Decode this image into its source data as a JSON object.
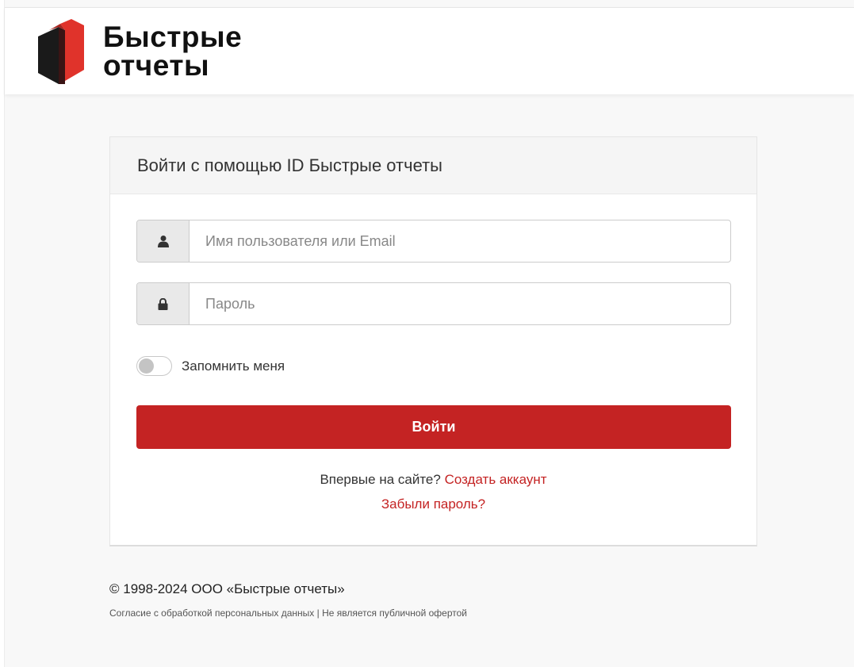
{
  "header": {
    "logo_line1": "Быстрые",
    "logo_line2": "отчеты"
  },
  "login": {
    "title": "Войти с помощью ID Быстрые отчеты",
    "username_placeholder": "Имя пользователя или Email",
    "username_value": "",
    "password_placeholder": "Пароль",
    "password_value": "",
    "remember_label": "Запомнить меня",
    "remember_checked": false,
    "submit_label": "Войти",
    "register_prompt": "Впервые на сайте?",
    "register_link": "Создать аккаунт",
    "forgot_link": "Забыли пароль?"
  },
  "footer": {
    "copyright": "© 1998-2024 ООО «Быстрые отчеты»",
    "consent_link": "Согласие с обработкой персональных данных",
    "separator": "|",
    "offer_note": "Не является публичной офертой"
  },
  "icons": {
    "username_icon": "user-icon",
    "password_icon": "lock-icon"
  },
  "colors": {
    "accent": "#c42323",
    "logo_red": "#e0332b",
    "logo_dark": "#1a1a1a"
  }
}
